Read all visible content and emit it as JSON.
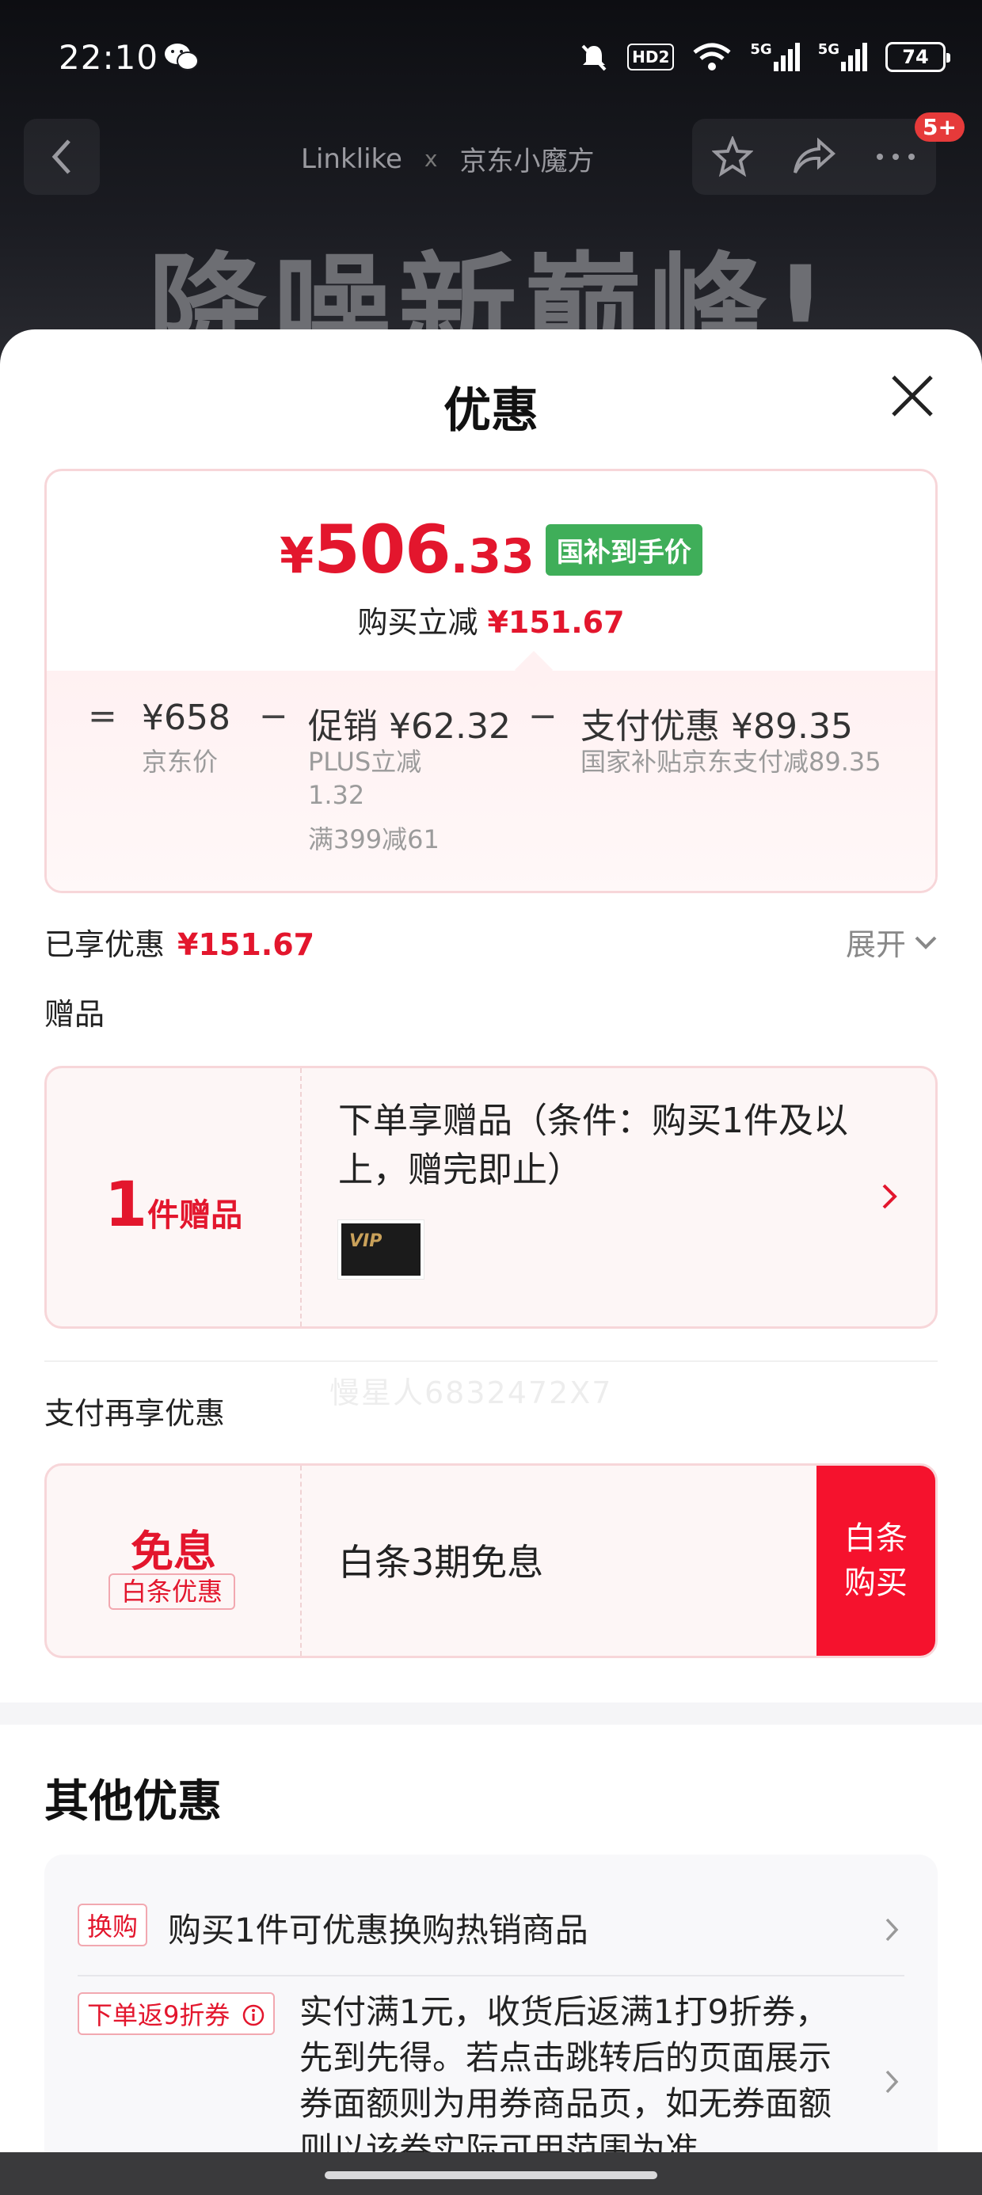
{
  "status_bar": {
    "time": "22:10",
    "hd": "HD2",
    "net1": "5G",
    "net2": "5G",
    "battery": "74"
  },
  "nav": {
    "brand_a": "Linklike",
    "brand_sep": "x",
    "brand_b": "京东小魔方",
    "badge": "5+"
  },
  "hero": {
    "headline": "降噪新巅峰!"
  },
  "sheet": {
    "title": "优惠",
    "price": {
      "currency": "¥",
      "integer": "506",
      "decimal": ".33",
      "tag": "国补到手价",
      "reduce_label": "购买立减",
      "reduce_amount": "¥151.67"
    },
    "calc": {
      "eq": "=",
      "jd_price": "¥658",
      "jd_price_label": "京东价",
      "minus1": "−",
      "promo": "促销 ¥62.32",
      "promo_sub1": "PLUS立减",
      "promo_sub2": "1.32",
      "promo_sub3": "满399减61",
      "minus2": "−",
      "pay": "支付优惠 ¥89.35",
      "pay_sub": "国家补贴京东支付减89.35"
    },
    "enjoyed_label": "已享优惠",
    "enjoyed_amount": "¥151.67",
    "expand_label": "展开",
    "gift_section": "赠品",
    "gift": {
      "count": "1",
      "count_unit": "件赠品",
      "text": "下单享赠品（条件：购买1件及以上，赠完即止）",
      "thumb": "VIP"
    },
    "watermark": "慢星人6832472X7",
    "pay_section": "支付再享优惠",
    "pay_offer": {
      "main": "免息",
      "tag": "白条优惠",
      "text": "白条3期免息",
      "btn_line1": "白条",
      "btn_line2": "购买"
    },
    "other_title": "其他优惠",
    "offers": [
      {
        "tag": "换购",
        "text": "购买1件可优惠换购热销商品"
      },
      {
        "tag": "下单返9折券",
        "text": "实付满1元，收货后返满1打9折券，先到先得。若点击跳转后的页面展示券面额则为用券商品页，如无券面额则以该券实际可用范围为准"
      }
    ]
  }
}
